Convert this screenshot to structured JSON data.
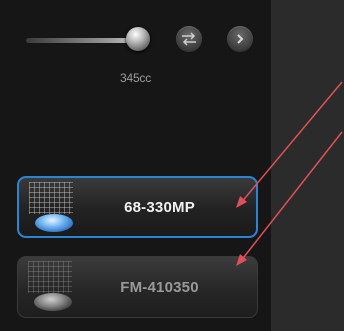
{
  "slider": {
    "value_label": "345cc"
  },
  "buttons": {
    "swap_icon": "swap-arrows-icon",
    "next_icon": "play-next-icon"
  },
  "devices": [
    {
      "label": "68-330MP",
      "selected": true,
      "icon": "lens-grid-icon"
    },
    {
      "label": "FM-410350",
      "selected": false,
      "icon": "lens-grid-icon"
    }
  ],
  "colors": {
    "accent": "#2c85d4",
    "panel": "#161616",
    "annotation_arrow": "#e0505a"
  }
}
